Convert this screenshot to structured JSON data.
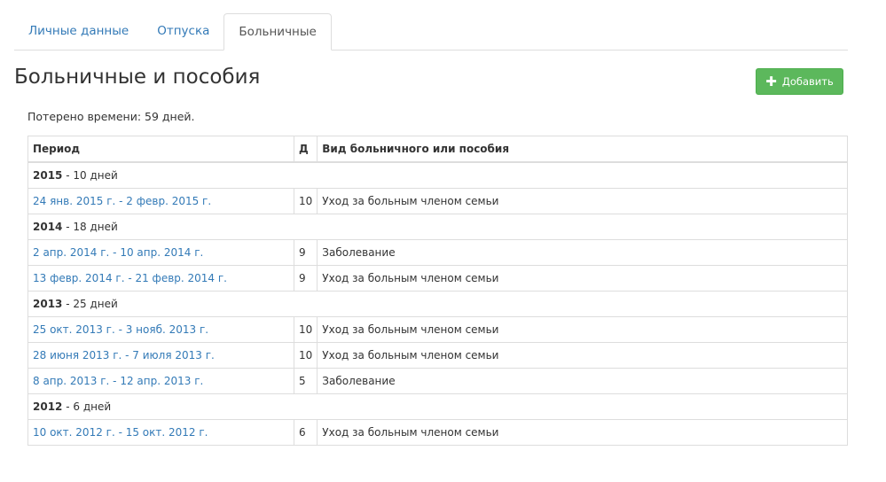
{
  "tabs": [
    "Личные данные",
    "Отпуска",
    "Больничные"
  ],
  "active_tab": 2,
  "title": "Больничные и пособия",
  "add_label": "Добавить",
  "lost_time": "Потерено времени: 59 дней.",
  "table": {
    "headers": [
      "Период",
      "Д",
      "Вид больничного или пособия"
    ],
    "groups": [
      {
        "year": "2015",
        "days": " - 10 дней",
        "rows": [
          {
            "period": "24 янв. 2015 г. - 2 февр. 2015 г.",
            "d": "10",
            "type": "Уход за больным членом семьи"
          }
        ]
      },
      {
        "year": "2014",
        "days": " - 18 дней",
        "rows": [
          {
            "period": "2 апр. 2014 г. - 10 апр. 2014 г.",
            "d": "9",
            "type": "Заболевание"
          },
          {
            "period": "13 февр. 2014 г. - 21 февр. 2014 г.",
            "d": "9",
            "type": "Уход за больным членом семьи"
          }
        ]
      },
      {
        "year": "2013",
        "days": " - 25 дней",
        "rows": [
          {
            "period": "25 окт. 2013 г. - 3 нояб. 2013 г.",
            "d": "10",
            "type": "Уход за больным членом семьи"
          },
          {
            "period": "28 июня 2013 г. - 7 июля 2013 г.",
            "d": "10",
            "type": "Уход за больным членом семьи"
          },
          {
            "period": "8 апр. 2013 г. - 12 апр. 2013 г.",
            "d": "5",
            "type": "Заболевание"
          }
        ]
      },
      {
        "year": "2012",
        "days": " - 6 дней",
        "rows": [
          {
            "period": "10 окт. 2012 г. - 15 окт. 2012 г.",
            "d": "6",
            "type": "Уход за больным членом семьи"
          }
        ]
      }
    ]
  }
}
